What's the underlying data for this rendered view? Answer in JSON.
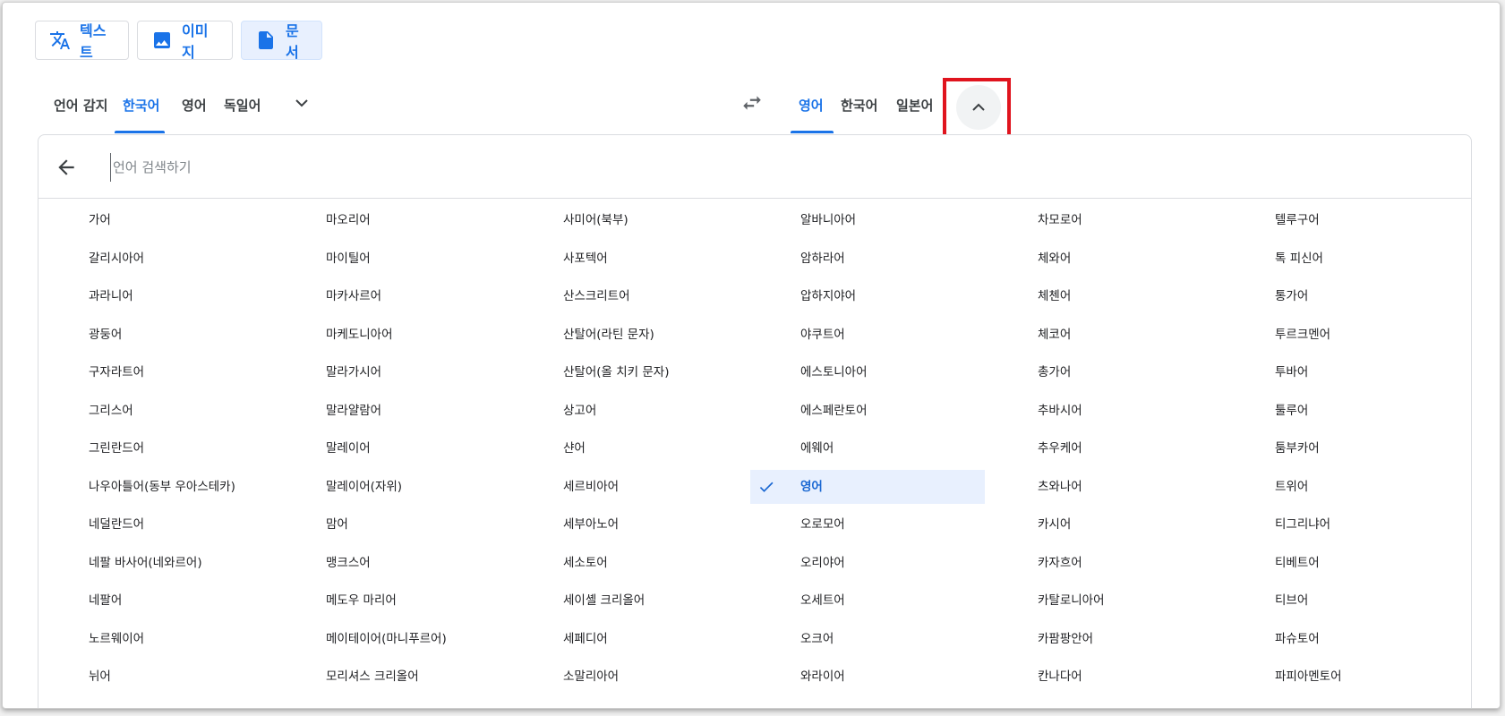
{
  "mode_tabs": [
    {
      "label": "텍스트",
      "icon": "translate-icon",
      "active": false
    },
    {
      "label": "이미지",
      "icon": "image-icon",
      "active": false
    },
    {
      "label": "문서",
      "icon": "document-icon",
      "active": true
    }
  ],
  "source_languages": [
    "언어 감지",
    "한국어",
    "영어",
    "독일어"
  ],
  "source_active": "한국어",
  "target_languages": [
    "영어",
    "한국어",
    "일본어"
  ],
  "target_active": "영어",
  "search": {
    "placeholder": "언어 검색하기",
    "value": ""
  },
  "selected_language": "영어",
  "language_columns": [
    [
      "가어",
      "갈리시아어",
      "과라니어",
      "광둥어",
      "구자라트어",
      "그리스어",
      "그린란드어",
      "나우아틀어(동부 우아스테카)",
      "네덜란드어",
      "네팔 바사어(네와르어)",
      "네팔어",
      "노르웨이어",
      "뉘어"
    ],
    [
      "마오리어",
      "마이틸어",
      "마카사르어",
      "마케도니아어",
      "말라가시어",
      "말라얄람어",
      "말레이어",
      "말레이어(자위)",
      "맘어",
      "맹크스어",
      "메도우 마리어",
      "메이테이어(마니푸르어)",
      "모리셔스 크리올어"
    ],
    [
      "사미어(북부)",
      "사포텍어",
      "산스크리트어",
      "산탈어(라틴 문자)",
      "산탈어(올 치키 문자)",
      "상고어",
      "샨어",
      "세르비아어",
      "세부아노어",
      "세소토어",
      "세이셸 크리올어",
      "세페디어",
      "소말리아어"
    ],
    [
      "알바니아어",
      "암하라어",
      "압하지야어",
      "야쿠트어",
      "에스토니아어",
      "에스페란토어",
      "에웨어",
      "영어",
      "오로모어",
      "오리야어",
      "오세트어",
      "오크어",
      "와라이어"
    ],
    [
      "차모로어",
      "체와어",
      "체첸어",
      "체코어",
      "총가어",
      "추바시어",
      "추우케어",
      "츠와나어",
      "카시어",
      "카자흐어",
      "카탈로니아어",
      "카팜팡안어",
      "칸나다어"
    ],
    [
      "텔루구어",
      "톡 피신어",
      "통가어",
      "투르크멘어",
      "투바어",
      "툴루어",
      "툼부카어",
      "트위어",
      "티그리냐어",
      "티베트어",
      "티브어",
      "파슈토어",
      "파피아멘토어"
    ]
  ],
  "colors": {
    "accent": "#1a73e8",
    "selected_bg": "#e8f0fe",
    "highlight": "#e0141e"
  }
}
